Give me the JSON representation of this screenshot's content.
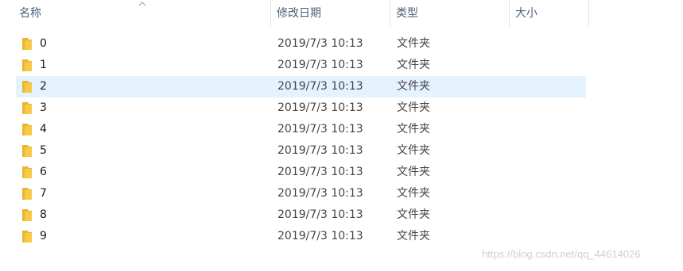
{
  "header": {
    "name": "名称",
    "date": "修改日期",
    "type": "类型",
    "size": "大小"
  },
  "rows": [
    {
      "name": "0",
      "date": "2019/7/3 10:13",
      "type": "文件夹",
      "selected": false
    },
    {
      "name": "1",
      "date": "2019/7/3 10:13",
      "type": "文件夹",
      "selected": false
    },
    {
      "name": "2",
      "date": "2019/7/3 10:13",
      "type": "文件夹",
      "selected": true
    },
    {
      "name": "3",
      "date": "2019/7/3 10:13",
      "type": "文件夹",
      "selected": false
    },
    {
      "name": "4",
      "date": "2019/7/3 10:13",
      "type": "文件夹",
      "selected": false
    },
    {
      "name": "5",
      "date": "2019/7/3 10:13",
      "type": "文件夹",
      "selected": false
    },
    {
      "name": "6",
      "date": "2019/7/3 10:13",
      "type": "文件夹",
      "selected": false
    },
    {
      "name": "7",
      "date": "2019/7/3 10:13",
      "type": "文件夹",
      "selected": false
    },
    {
      "name": "8",
      "date": "2019/7/3 10:13",
      "type": "文件夹",
      "selected": false
    },
    {
      "name": "9",
      "date": "2019/7/3 10:13",
      "type": "文件夹",
      "selected": false
    }
  ],
  "watermark": "https://blog.csdn.net/qq_44614026",
  "colors": {
    "folder": "#f7c948",
    "folder_dark": "#e8b52d",
    "selected_bg": "#e5f3ff",
    "header_text": "#4c607a"
  },
  "icons": {
    "sort": "sort-ascending-icon",
    "folder": "folder-icon"
  }
}
